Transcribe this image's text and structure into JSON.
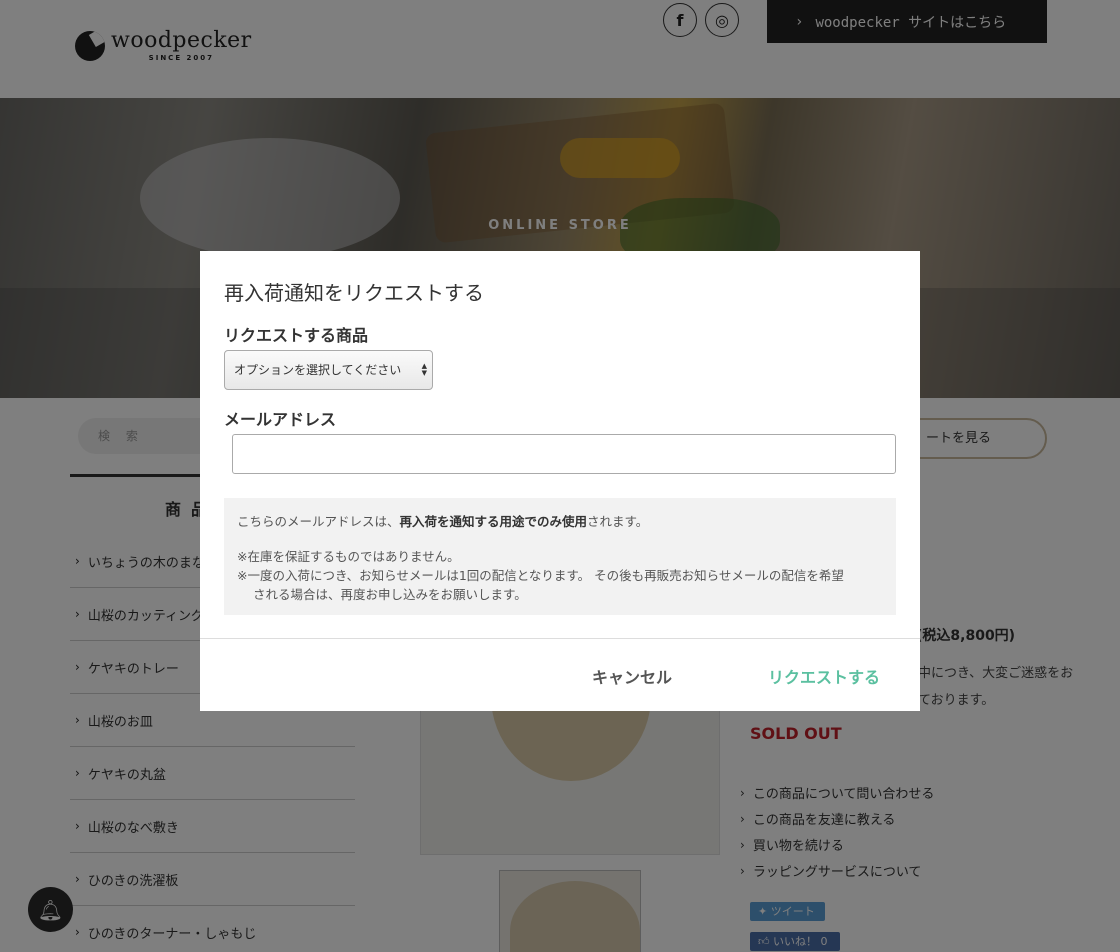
{
  "header": {
    "logo_text": "woodpecker",
    "logo_since": "SINCE 2007",
    "social": [
      {
        "icon": "facebook-icon",
        "glyph": "f"
      },
      {
        "icon": "instagram-icon",
        "glyph": "◎"
      }
    ],
    "site_link_label": "woodpecker サイトはこちら"
  },
  "hero": {
    "kicker": "ONLINE STORE"
  },
  "search": {
    "placeholder": "検 索"
  },
  "cart": {
    "view_label": "ートを見る"
  },
  "sidebar": {
    "heading": "商品",
    "items": [
      {
        "label": "いちょうの木のまな"
      },
      {
        "label": "山桜のカッティング"
      },
      {
        "label": "ケヤキのトレー"
      },
      {
        "label": "山桜のお皿"
      },
      {
        "label": "ケヤキの丸盆"
      },
      {
        "label": "山桜のなべ敷き"
      },
      {
        "label": "ひのきの洗濯板"
      },
      {
        "label": "ひのきのターナー・しゃもじ"
      }
    ]
  },
  "product": {
    "price": "(税込8,800円)",
    "notice_line1": "中につき、大変ご迷惑をお",
    "notice_line2": "ております。",
    "sold_out": "SOLD OUT",
    "links": [
      {
        "label": "この商品について問い合わせる"
      },
      {
        "label": "この商品を友達に教える"
      },
      {
        "label": "買い物を続ける"
      },
      {
        "label": "ラッピングサービスについて"
      }
    ],
    "tweet_label": "ツイート",
    "like_label": "いいね！ 0"
  },
  "modal": {
    "title": "再入荷通知をリクエストする",
    "product_label": "リクエストする商品",
    "select_value": "オプションを選択してください",
    "email_label": "メールアドレス",
    "email_value": "",
    "info_prefix": "こちらのメールアドレスは、",
    "info_bold": "再入荷を通知する用途でのみ使用",
    "info_suffix": "されます。",
    "info_note1": "※在庫を保証するものではありません。",
    "info_note2": "※一度の入荷につき、お知らせメールは1回の配信となります。 その後も再販売お知らせメールの配信を希望",
    "info_note3": "される場合は、再度お申し込みをお願いします。",
    "cancel_label": "キャンセル",
    "request_label": "リクエストする"
  },
  "colors": {
    "accent": "#5bc0a0",
    "sold_out": "#c0202a",
    "dark": "#222222"
  }
}
